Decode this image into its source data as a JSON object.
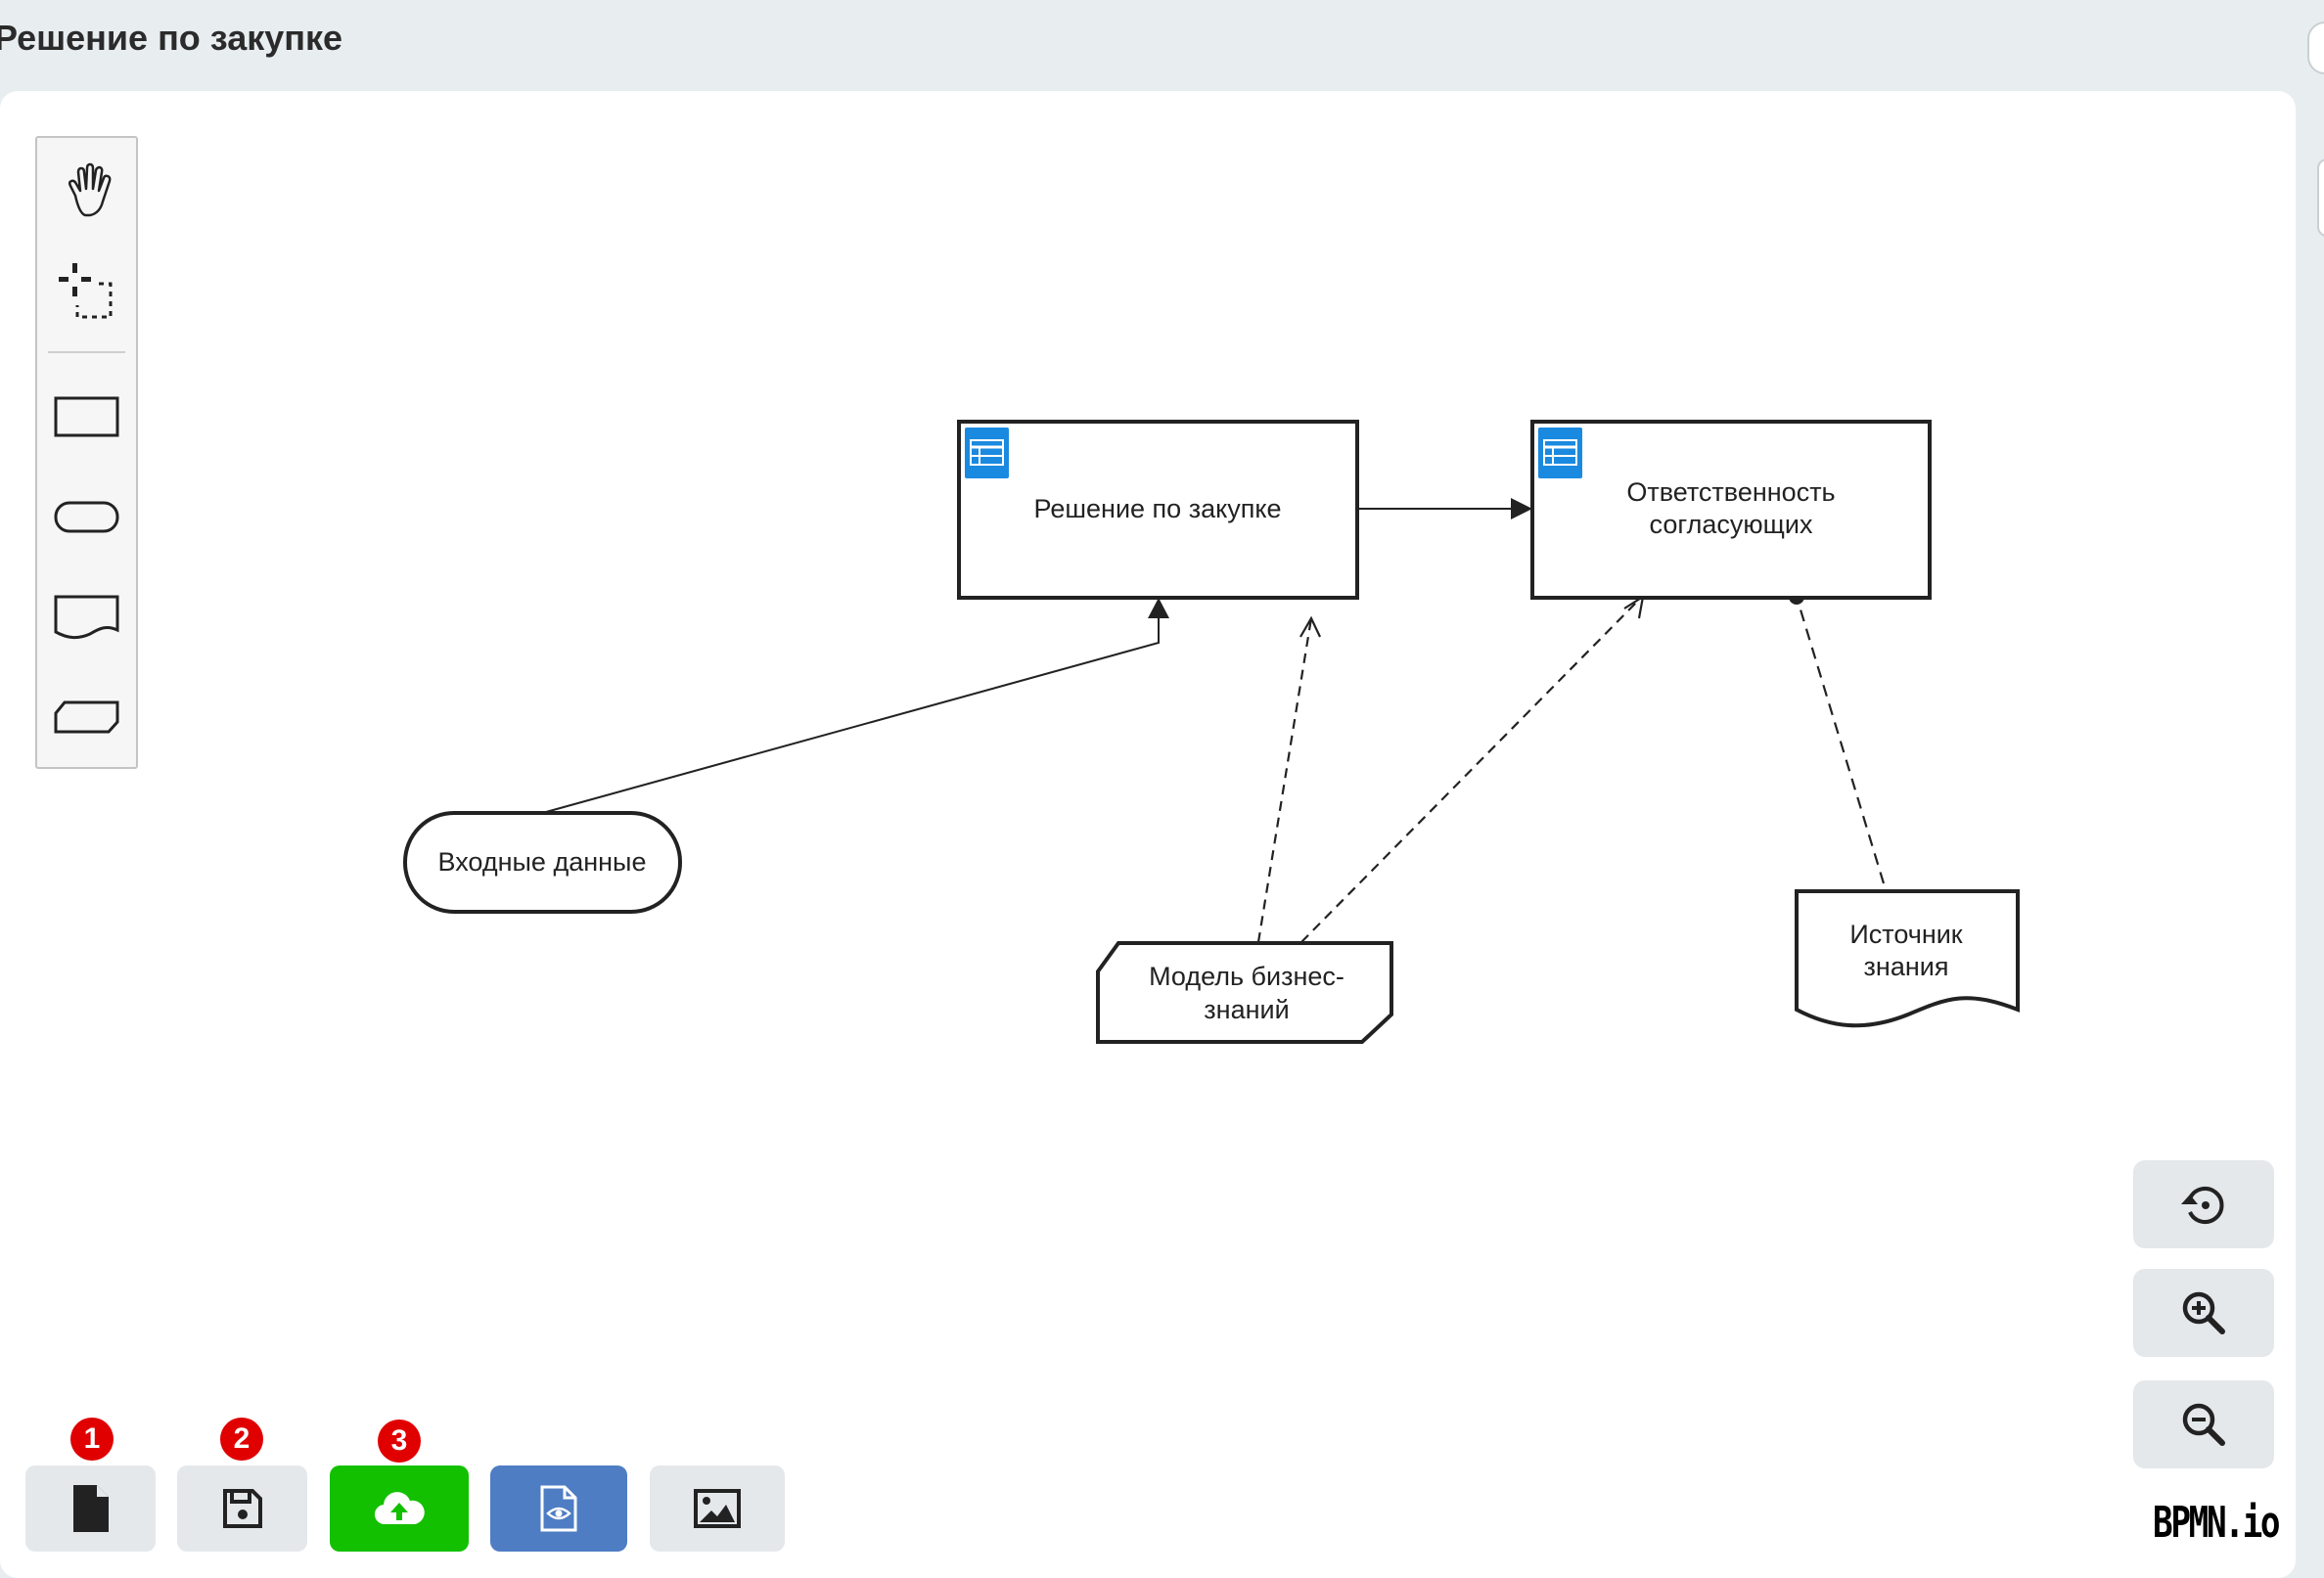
{
  "header": {
    "title": "Решение по закупке"
  },
  "palette": {
    "tools": [
      {
        "icon": "hand-tool-icon"
      },
      {
        "icon": "lasso-tool-icon"
      },
      {
        "icon": "decision-shape-icon"
      },
      {
        "icon": "input-data-shape-icon"
      },
      {
        "icon": "knowledge-source-shape-icon"
      },
      {
        "icon": "business-knowledge-model-shape-icon"
      }
    ]
  },
  "diagram": {
    "decision1": {
      "label": "Решение по закупке"
    },
    "decision2": {
      "label_line1": "Ответственность",
      "label_line2": "согласующих"
    },
    "input_data": {
      "label": "Входные данные"
    },
    "bkm": {
      "label_line1": "Модель бизнес-",
      "label_line2": "знаний"
    },
    "knowledge_source": {
      "label_line1": "Источник",
      "label_line2": "знания"
    }
  },
  "zoom_controls": [
    {
      "icon": "reset-zoom-icon"
    },
    {
      "icon": "zoom-in-icon"
    },
    {
      "icon": "zoom-out-icon"
    }
  ],
  "toolbar": {
    "buttons": [
      {
        "icon": "new-file-icon",
        "badge": "1",
        "color": "#e4e8eb"
      },
      {
        "icon": "save-icon",
        "badge": "2",
        "color": "#e4e8eb"
      },
      {
        "icon": "cloud-upload-icon",
        "badge": "3",
        "color": "#13c000"
      },
      {
        "icon": "preview-file-icon",
        "color": "#4e7dc4"
      },
      {
        "icon": "image-export-icon",
        "color": "#e4e8eb"
      }
    ]
  },
  "logo": {
    "text": "BPMN.io"
  },
  "colors": {
    "decision_icon": "#1a8ae0",
    "upload_button": "#13c000",
    "preview_button": "#4e7dc4",
    "badge": "#e00000"
  }
}
